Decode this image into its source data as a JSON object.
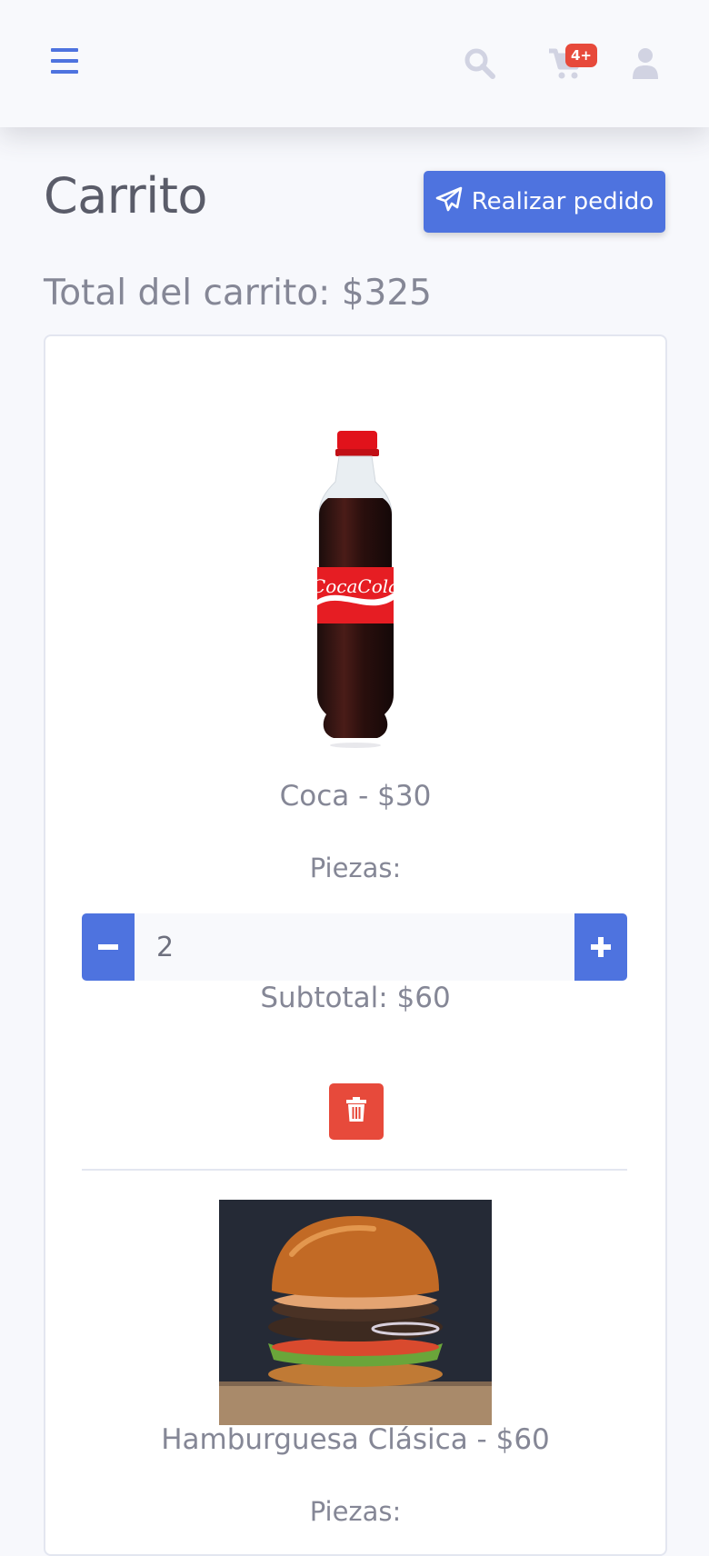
{
  "topbar": {
    "menu_icon": "hamburger-icon",
    "search_icon": "search-icon",
    "cart_icon": "shopping-cart-icon",
    "cart_badge": "4+",
    "user_icon": "user-icon"
  },
  "page": {
    "title": "Carrito",
    "order_button_label": "Realizar pedido",
    "order_button_icon": "paper-plane-icon",
    "cart_total": "Total del carrito: $325"
  },
  "cart_items": [
    {
      "title": "Coca - $30",
      "image": "soda-bottle-image",
      "pieces_label": "Piezas:",
      "quantity": "2",
      "subtotal": "Subtotal: $60",
      "delete_icon": "trash-icon"
    },
    {
      "title": "Hamburguesa Clásica - $60",
      "image": "burger-image",
      "pieces_label": "Piezas:"
    }
  ],
  "colors": {
    "primary": "#4e73df",
    "danger": "#e74a3b",
    "text_gray": "#858796"
  }
}
